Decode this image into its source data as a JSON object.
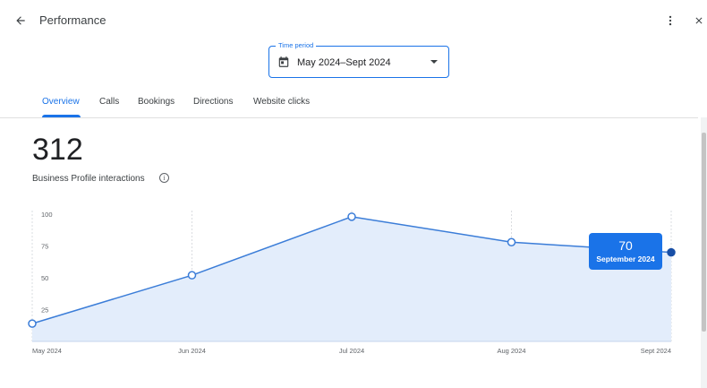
{
  "header": {
    "title": "Performance",
    "back_icon": "arrow-back-icon",
    "more_icon": "more-vert-icon",
    "close_icon": "close-icon"
  },
  "time_period": {
    "label": "Time period",
    "value": "May 2024–Sept 2024",
    "icon": "calendar-icon"
  },
  "tabs": [
    {
      "label": "Overview",
      "active": true
    },
    {
      "label": "Calls",
      "active": false
    },
    {
      "label": "Bookings",
      "active": false
    },
    {
      "label": "Directions",
      "active": false
    },
    {
      "label": "Website clicks",
      "active": false
    }
  ],
  "summary": {
    "total": "312",
    "label": "Business Profile interactions",
    "info_icon": "info-icon"
  },
  "tooltip": {
    "value": "70",
    "date": "September 2024"
  },
  "colors": {
    "accent": "#1a73e8",
    "line": "#3b7dd8",
    "area": "#e3edfb",
    "selected_point": "#174ea6"
  },
  "chart_data": {
    "type": "area",
    "categories": [
      "May 2024",
      "Jun 2024",
      "Jul 2024",
      "Aug 2024",
      "Sept 2024"
    ],
    "values": [
      14,
      52,
      98,
      78,
      70
    ],
    "y_ticks": [
      "100",
      "75",
      "50",
      "25"
    ],
    "ylim": [
      0,
      100
    ],
    "grid": "vertical dashed",
    "selected_index": 4
  }
}
